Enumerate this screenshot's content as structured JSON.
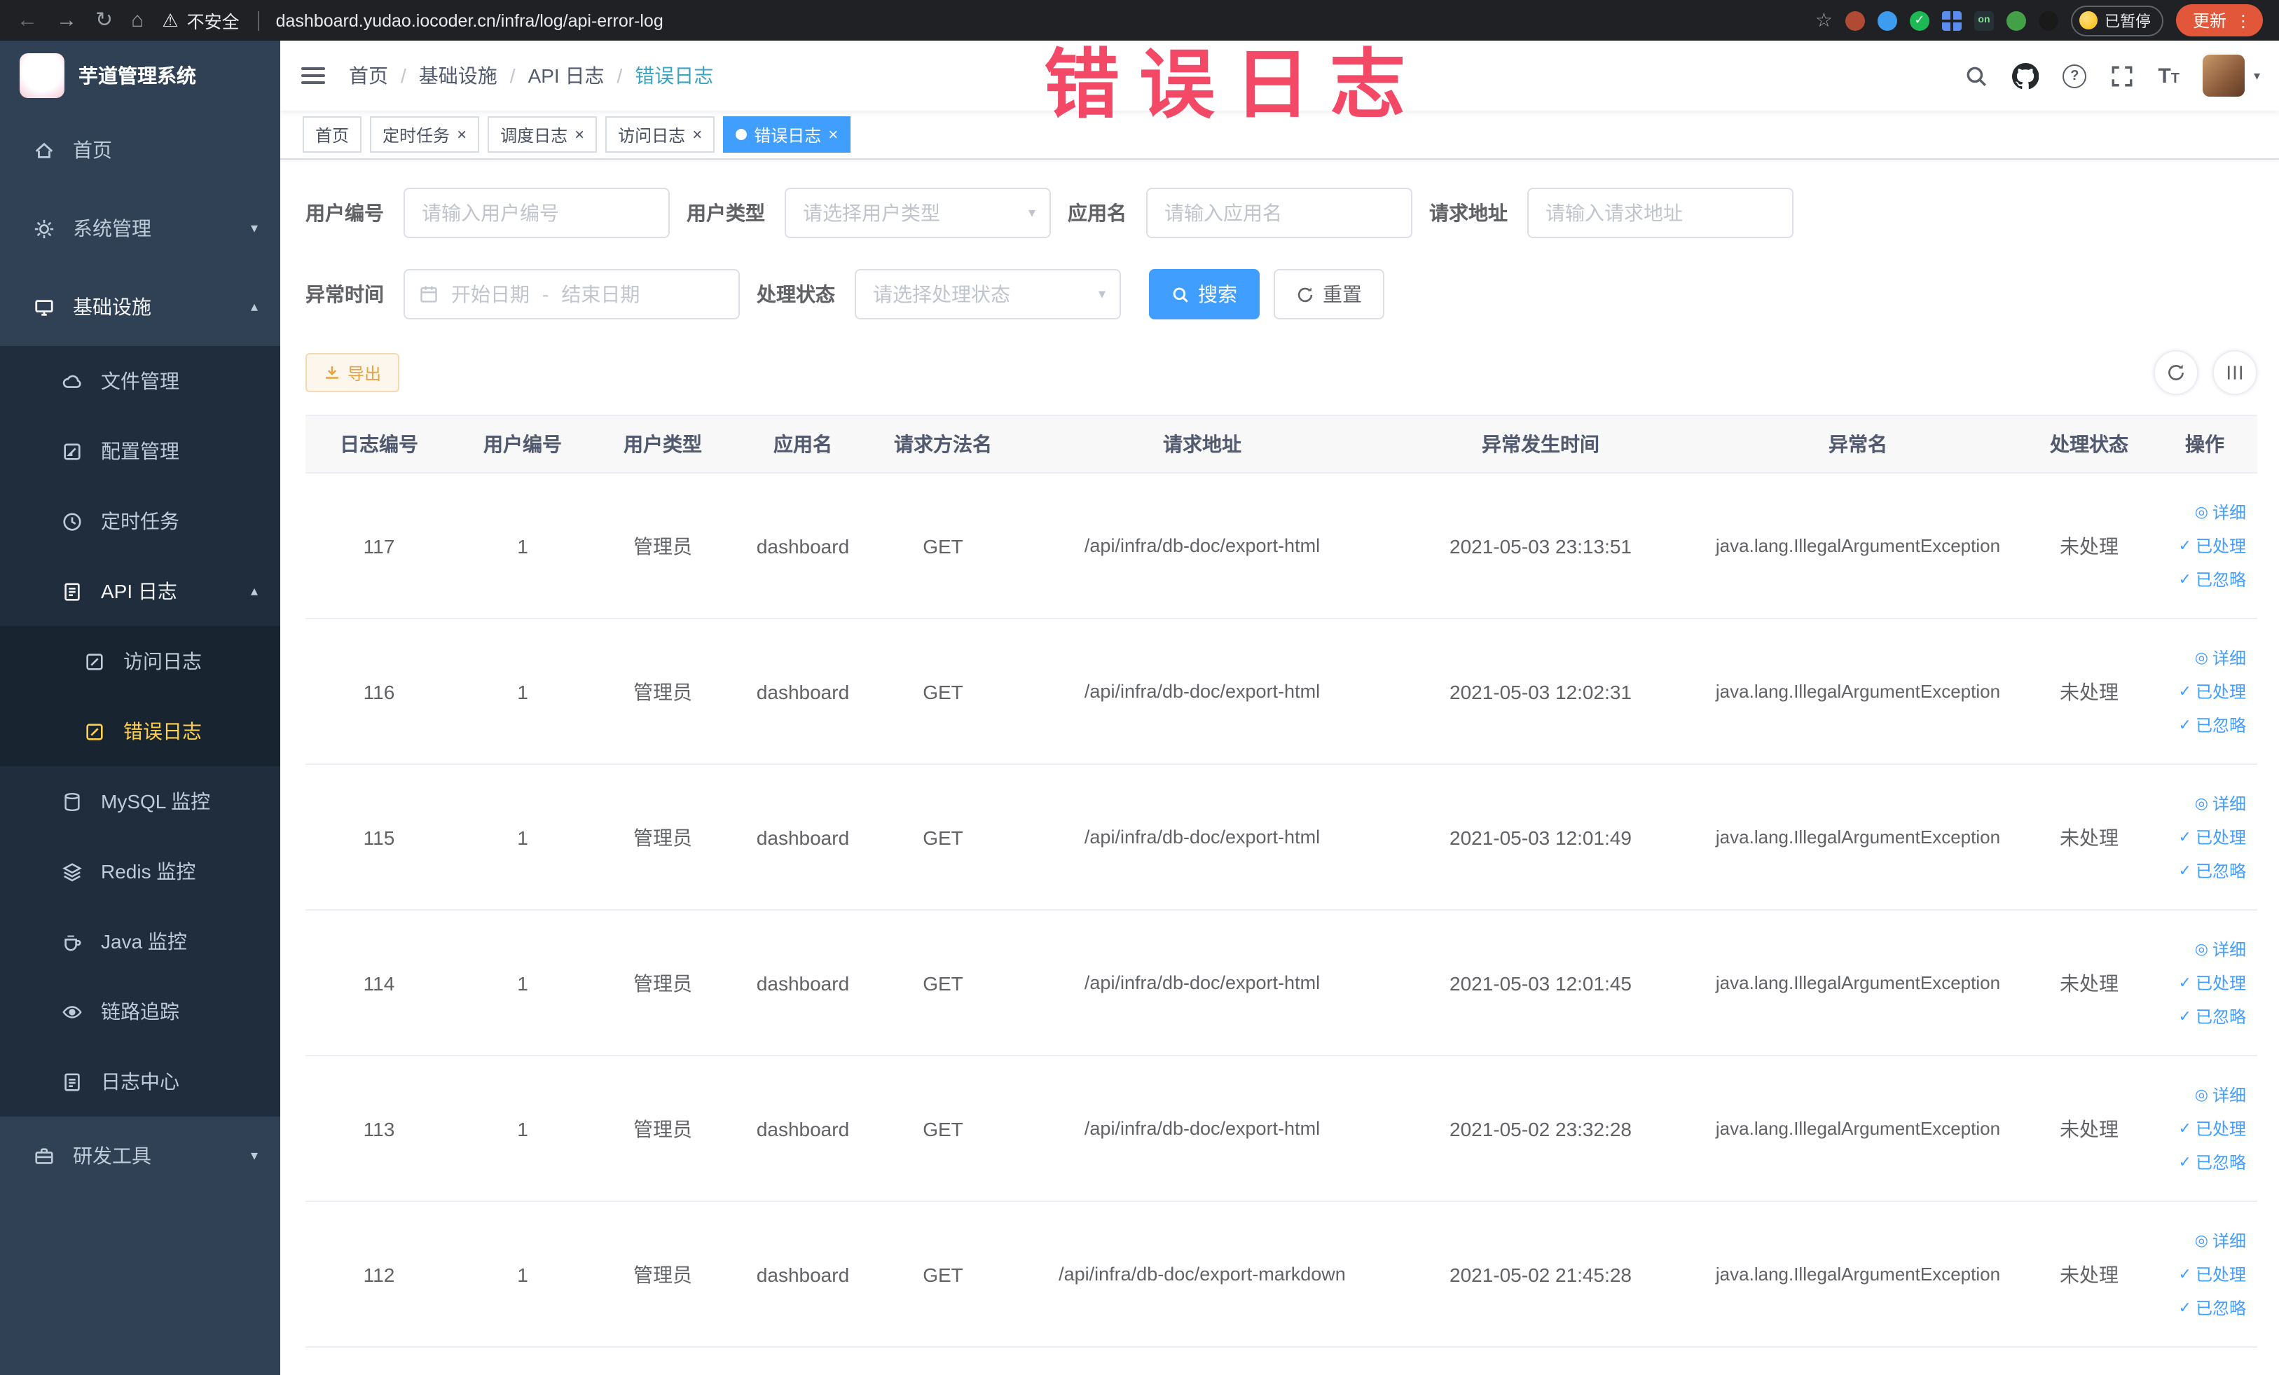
{
  "colors": {
    "primary": "#409eff",
    "chrome_bg": "#202124",
    "sidebar_bg": "#304156",
    "sidebar_submenu_bg": "#1f2d3d",
    "sidebar_active_text": "#ffd04b",
    "tag_active_bg": "#409eff",
    "export_button_text": "#e6a23c",
    "update_button_bg": "#e25739",
    "annotation_text": "#f23a5b",
    "breadcrumb_active": "#3ba3c0"
  },
  "browser": {
    "security_label": "不安全",
    "url": "dashboard.yudao.iocoder.cn/infra/log/api-error-log",
    "paused_label": "已暂停",
    "update_label": "更新",
    "on_badge": "on"
  },
  "annotation": {
    "text": "错误日志"
  },
  "sidebar": {
    "logo_title": "芋道管理系统",
    "menu": {
      "home": "首页",
      "system": "系统管理",
      "infra": "基础设施",
      "file": "文件管理",
      "config": "配置管理",
      "job": "定时任务",
      "api_log": "API 日志",
      "access_log": "访问日志",
      "error_log": "错误日志",
      "mysql": "MySQL 监控",
      "redis": "Redis 监控",
      "java": "Java 监控",
      "trace": "链路追踪",
      "log_center": "日志中心",
      "dev_tools": "研发工具"
    }
  },
  "header": {
    "breadcrumb": [
      "首页",
      "基础设施",
      "API 日志",
      "错误日志"
    ]
  },
  "tabs": [
    {
      "label": "首页",
      "active": false,
      "closable": false
    },
    {
      "label": "定时任务",
      "active": false,
      "closable": true
    },
    {
      "label": "调度日志",
      "active": false,
      "closable": true
    },
    {
      "label": "访问日志",
      "active": false,
      "closable": true
    },
    {
      "label": "错误日志",
      "active": true,
      "closable": true
    }
  ],
  "filters": {
    "user_id_label": "用户编号",
    "user_id_placeholder": "请输入用户编号",
    "user_type_label": "用户类型",
    "user_type_placeholder": "请选择用户类型",
    "app_name_label": "应用名",
    "app_name_placeholder": "请输入应用名",
    "request_url_label": "请求地址",
    "request_url_placeholder": "请输入请求地址",
    "time_label": "异常时间",
    "time_start_placeholder": "开始日期",
    "time_separator": "-",
    "time_end_placeholder": "结束日期",
    "status_label": "处理状态",
    "status_placeholder": "请选择处理状态",
    "search_button": "搜索",
    "reset_button": "重置"
  },
  "toolbar": {
    "export_button": "导出"
  },
  "table": {
    "columns": [
      "日志编号",
      "用户编号",
      "用户类型",
      "应用名",
      "请求方法名",
      "请求地址",
      "异常发生时间",
      "异常名",
      "处理状态",
      "操作"
    ],
    "actions": {
      "detail": "详细",
      "processed": "已处理",
      "ignored": "已忽略"
    },
    "rows": [
      {
        "id": "117",
        "user_id": "1",
        "user_type": "管理员",
        "app": "dashboard",
        "method": "GET",
        "url": "/api/infra/db-doc/export-html",
        "time": "2021-05-03 23:13:51",
        "exception": "java.lang.IllegalArgumentException",
        "status": "未处理"
      },
      {
        "id": "116",
        "user_id": "1",
        "user_type": "管理员",
        "app": "dashboard",
        "method": "GET",
        "url": "/api/infra/db-doc/export-html",
        "time": "2021-05-03 12:02:31",
        "exception": "java.lang.IllegalArgumentException",
        "status": "未处理"
      },
      {
        "id": "115",
        "user_id": "1",
        "user_type": "管理员",
        "app": "dashboard",
        "method": "GET",
        "url": "/api/infra/db-doc/export-html",
        "time": "2021-05-03 12:01:49",
        "exception": "java.lang.IllegalArgumentException",
        "status": "未处理"
      },
      {
        "id": "114",
        "user_id": "1",
        "user_type": "管理员",
        "app": "dashboard",
        "method": "GET",
        "url": "/api/infra/db-doc/export-html",
        "time": "2021-05-03 12:01:45",
        "exception": "java.lang.IllegalArgumentException",
        "status": "未处理"
      },
      {
        "id": "113",
        "user_id": "1",
        "user_type": "管理员",
        "app": "dashboard",
        "method": "GET",
        "url": "/api/infra/db-doc/export-html",
        "time": "2021-05-02 23:32:28",
        "exception": "java.lang.IllegalArgumentException",
        "status": "未处理"
      },
      {
        "id": "112",
        "user_id": "1",
        "user_type": "管理员",
        "app": "dashboard",
        "method": "GET",
        "url": "/api/infra/db-doc/export-markdown",
        "time": "2021-05-02 21:45:28",
        "exception": "java.lang.IllegalArgumentException",
        "status": "未处理"
      }
    ]
  },
  "icons": {
    "back": "←",
    "forward": "→",
    "reload": "↻",
    "home": "⌂",
    "warning": "⚠",
    "star": "☆",
    "kebab": "⋮",
    "close": "×",
    "active_dot": "",
    "chevron_down": "▾",
    "chevron_up": "▴",
    "view": "◎",
    "check": "✓",
    "question": "?",
    "text_size": "T",
    "breadcrumb_separator": "/"
  }
}
